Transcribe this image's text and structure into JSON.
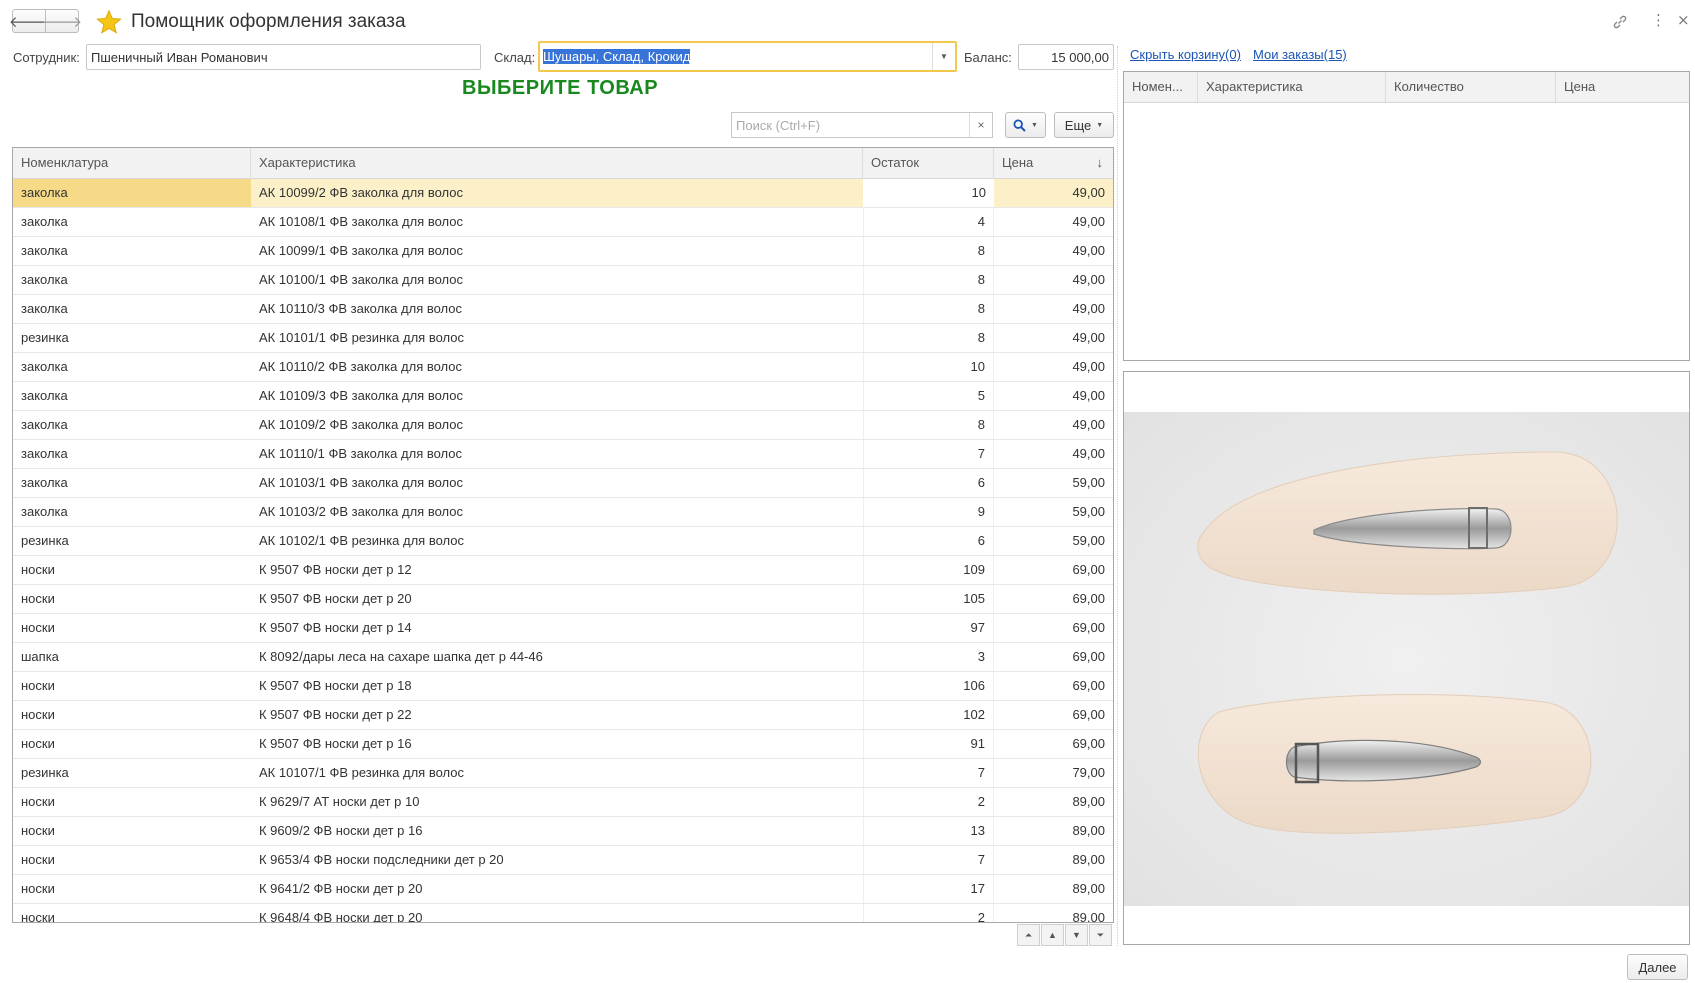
{
  "window": {
    "title": "Помощник оформления заказа",
    "back_icon": "arrow-left-icon",
    "forward_icon": "arrow-right-icon",
    "favorite_icon": "star-icon",
    "link_icon": "link-icon",
    "more_icon": "more-vert-icon",
    "close_icon": "close-icon"
  },
  "form": {
    "employee_label": "Сотрудник:",
    "employee_value": "Пшеничный Иван Романович",
    "warehouse_label": "Склад:",
    "warehouse_value": "Шушары, Склад, Крокид",
    "balance_label": "Баланс:",
    "balance_value": "15 000,00",
    "heading": "ВЫБЕРИТЕ ТОВАР",
    "heading_color": "#19891f"
  },
  "links": {
    "hide_basket": "Скрыть корзину(0)",
    "my_orders": "Мои заказы(15)"
  },
  "toolbar": {
    "search_placeholder": "Поиск (Ctrl+F)",
    "clear_glyph": "×",
    "search_icon": "search-icon",
    "more_label": "Еще"
  },
  "table": {
    "columns": [
      "Номенклатура",
      "Характеристика",
      "Остаток",
      "Цена"
    ],
    "sort_indicator": "↓",
    "rows": [
      [
        "заколка",
        "АК 10099/2 ФВ заколка для волос",
        "10",
        "49,00"
      ],
      [
        "заколка",
        "АК 10108/1 ФВ заколка для волос",
        "4",
        "49,00"
      ],
      [
        "заколка",
        "АК 10099/1 ФВ заколка для волос",
        "8",
        "49,00"
      ],
      [
        "заколка",
        "АК 10100/1 ФВ заколка для волос",
        "8",
        "49,00"
      ],
      [
        "заколка",
        "АК 10110/3 ФВ заколка для волос",
        "8",
        "49,00"
      ],
      [
        "резинка",
        "АК 10101/1 ФВ резинка для волос",
        "8",
        "49,00"
      ],
      [
        "заколка",
        "АК 10110/2 ФВ заколка для волос",
        "10",
        "49,00"
      ],
      [
        "заколка",
        "АК 10109/3 ФВ заколка для волос",
        "5",
        "49,00"
      ],
      [
        "заколка",
        "АК 10109/2 ФВ заколка для волос",
        "8",
        "49,00"
      ],
      [
        "заколка",
        "АК 10110/1 ФВ заколка для волос",
        "7",
        "49,00"
      ],
      [
        "заколка",
        "АК 10103/1 ФВ заколка для волос",
        "6",
        "59,00"
      ],
      [
        "заколка",
        "АК 10103/2 ФВ заколка для волос",
        "9",
        "59,00"
      ],
      [
        "резинка",
        "АК 10102/1 ФВ резинка для волос",
        "6",
        "59,00"
      ],
      [
        "носки",
        "К 9507 ФВ носки дет р 12",
        "109",
        "69,00"
      ],
      [
        "носки",
        "К 9507 ФВ носки дет р 20",
        "105",
        "69,00"
      ],
      [
        "носки",
        "К 9507 ФВ носки дет р 14",
        "97",
        "69,00"
      ],
      [
        "шапка",
        "К 8092/дары леса на сахаре шапка дет р 44-46",
        "3",
        "69,00"
      ],
      [
        "носки",
        "К 9507 ФВ носки дет р 18",
        "106",
        "69,00"
      ],
      [
        "носки",
        "К 9507 ФВ носки дет р 22",
        "102",
        "69,00"
      ],
      [
        "носки",
        "К 9507 ФВ носки дет р 16",
        "91",
        "69,00"
      ],
      [
        "резинка",
        "АК 10107/1 ФВ резинка для волос",
        "7",
        "79,00"
      ],
      [
        "носки",
        "К 9629/7 АТ носки дет р 10",
        "2",
        "89,00"
      ],
      [
        "носки",
        "К 9609/2 ФВ носки дет р 16",
        "13",
        "89,00"
      ],
      [
        "носки",
        "К 9653/4 ФВ носки подследники дет р 20",
        "7",
        "89,00"
      ],
      [
        "носки",
        "К 9641/2 ФВ носки дет р 20",
        "17",
        "89,00"
      ],
      [
        "носки",
        "К 9648/4 ФВ носки дет р 20",
        "2",
        "89,00"
      ]
    ]
  },
  "basket": {
    "columns": [
      "Номен...",
      "Характеристика",
      "Количество",
      "Цена"
    ]
  },
  "footer": {
    "next_label": "Далее"
  }
}
